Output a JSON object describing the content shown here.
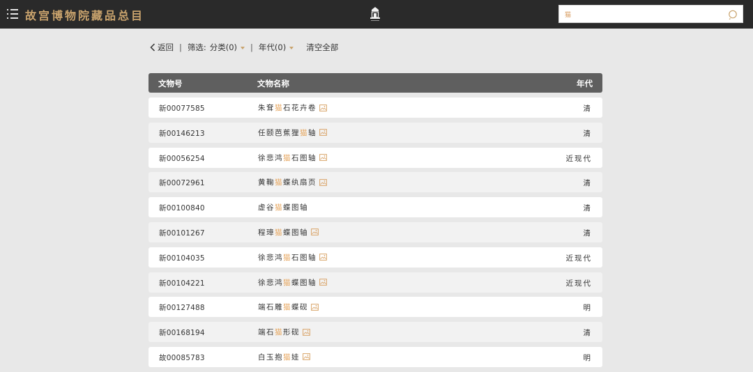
{
  "header": {
    "title": "故宫博物院藏品总目",
    "menu_icon": "menu-icon",
    "logo_icon": "palace-logo-icon"
  },
  "search": {
    "value": "猫",
    "icon": "search-icon"
  },
  "filters": {
    "back_label": "返回",
    "separator": "|",
    "filter_label": "筛选:",
    "category_label": "分类(0)",
    "era_label": "年代(0)",
    "clear_label": "清空全部"
  },
  "table": {
    "columns": {
      "id": "文物号",
      "name": "文物名称",
      "era": "年代"
    },
    "rows": [
      {
        "id": "新00077585",
        "name_pre": "朱耷",
        "name_hl": "猫",
        "name_post": "石花卉卷",
        "has_image": true,
        "era": "清"
      },
      {
        "id": "新00146213",
        "name_pre": "任颐芭蕉狸",
        "name_hl": "猫",
        "name_post": "轴",
        "has_image": true,
        "era": "清"
      },
      {
        "id": "新00056254",
        "name_pre": "徐悲鸿",
        "name_hl": "猫",
        "name_post": "石图轴",
        "has_image": true,
        "era": "近现代"
      },
      {
        "id": "新00072961",
        "name_pre": "黄鞠",
        "name_hl": "猫",
        "name_post": "蝶纨扇页",
        "has_image": true,
        "era": "清"
      },
      {
        "id": "新00100840",
        "name_pre": "虚谷",
        "name_hl": "猫",
        "name_post": "蝶图轴",
        "has_image": false,
        "era": "清"
      },
      {
        "id": "新00101267",
        "name_pre": "程璋",
        "name_hl": "猫",
        "name_post": "蝶图轴",
        "has_image": true,
        "era": "清"
      },
      {
        "id": "新00104035",
        "name_pre": "徐悲鸿",
        "name_hl": "猫",
        "name_post": "石图轴",
        "has_image": true,
        "era": "近现代"
      },
      {
        "id": "新00104221",
        "name_pre": "徐悲鸿",
        "name_hl": "猫",
        "name_post": "蝶图轴",
        "has_image": true,
        "era": "近现代"
      },
      {
        "id": "新00127488",
        "name_pre": "端石雕",
        "name_hl": "猫",
        "name_post": "蝶砚",
        "has_image": true,
        "era": "明"
      },
      {
        "id": "新00168194",
        "name_pre": "端石",
        "name_hl": "猫",
        "name_post": "形砚",
        "has_image": true,
        "era": "清"
      },
      {
        "id": "故00085783",
        "name_pre": "白玉抱",
        "name_hl": "猫",
        "name_post": "娃",
        "has_image": true,
        "era": "明"
      }
    ]
  },
  "colors": {
    "header_bg": "#2a2a2a",
    "title_gold": "#c9a36d",
    "highlight": "#e6a65f",
    "table_header_bg": "#5f5f5f",
    "page_bg": "#e8e8e8"
  }
}
